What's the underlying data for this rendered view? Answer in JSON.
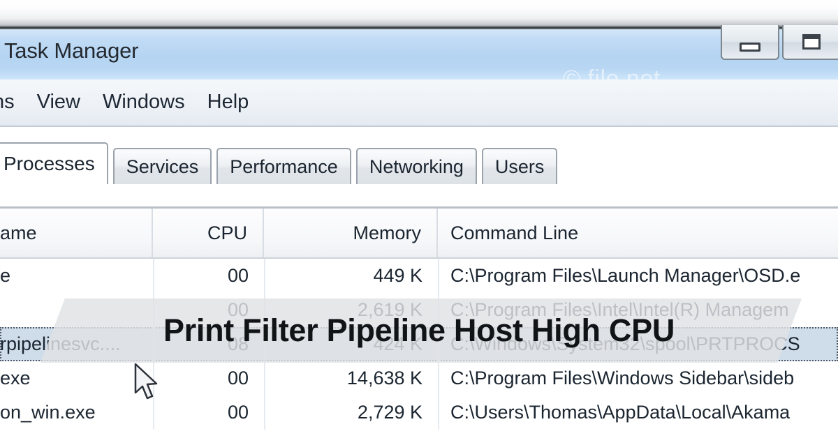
{
  "window": {
    "title": "Task Manager",
    "watermark": "© file.net",
    "buttons": [
      {
        "name": "minimize",
        "glyph": "minimize-icon"
      },
      {
        "name": "maximize",
        "glyph": "maximize-icon"
      }
    ]
  },
  "menu": {
    "items": [
      {
        "label": "ns"
      },
      {
        "label": "View"
      },
      {
        "label": "Windows"
      },
      {
        "label": "Help"
      }
    ]
  },
  "tabs": [
    {
      "label": "Processes",
      "active": true
    },
    {
      "label": "Services",
      "active": false
    },
    {
      "label": "Performance",
      "active": false
    },
    {
      "label": "Networking",
      "active": false
    },
    {
      "label": "Users",
      "active": false
    }
  ],
  "table": {
    "columns": [
      {
        "key": "name",
        "label": "ame",
        "align": "left"
      },
      {
        "key": "cpu",
        "label": "CPU",
        "align": "right"
      },
      {
        "key": "memory",
        "label": "Memory",
        "align": "right"
      },
      {
        "key": "command",
        "label": "Command Line",
        "align": "left"
      }
    ],
    "rows": [
      {
        "name": "e",
        "cpu": "00",
        "memory": "449 K",
        "command": "C:\\Program Files\\Launch Manager\\OSD.e",
        "selected": false
      },
      {
        "name": "",
        "cpu": "00",
        "memory": "2,619 K",
        "command": "C:\\Program Files\\Intel\\Intel(R) Managem",
        "selected": false
      },
      {
        "name": "rpipelinesvc....",
        "cpu": "08",
        "memory": "424 K",
        "command": "C:\\Windows\\System32\\spool\\PRTPROCS",
        "selected": true
      },
      {
        "name": "exe",
        "cpu": "00",
        "memory": "14,638 K",
        "command": "C:\\Program Files\\Windows Sidebar\\sideb",
        "selected": false
      },
      {
        "name": "on_win.exe",
        "cpu": "00",
        "memory": "2,729 K",
        "command": "C:\\Users\\Thomas\\AppData\\Local\\Akama",
        "selected": false
      }
    ]
  },
  "overlay": {
    "headline": "Print Filter Pipeline Host High CPU"
  },
  "colors": {
    "titlebar": "#b4d4f2",
    "selection": "#cfdcea",
    "banner": "#e1e2e4",
    "text": "#1b2530"
  }
}
